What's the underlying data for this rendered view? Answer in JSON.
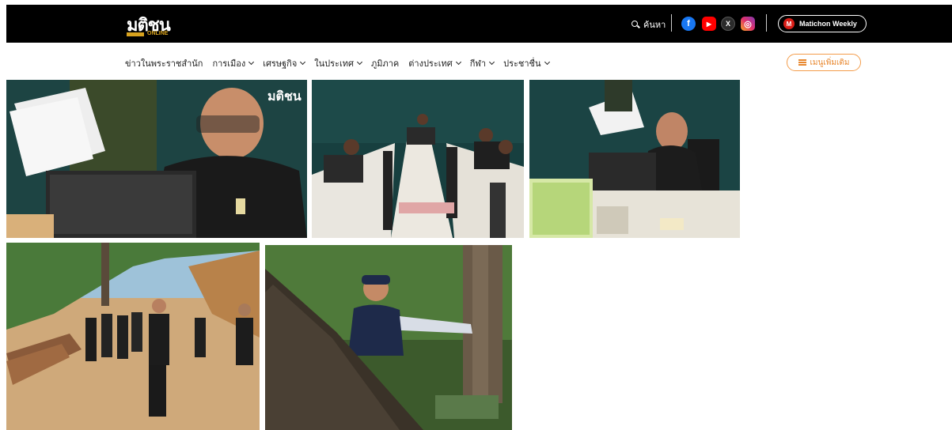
{
  "header": {
    "logo_main": "มติชน",
    "logo_sub": "ONLINE",
    "search_label": "ค้นหา",
    "social": [
      {
        "icon": "facebook-icon",
        "glyph": "f",
        "color": "#1877f2"
      },
      {
        "icon": "youtube-icon",
        "glyph": "▶",
        "color": "#ff0000"
      },
      {
        "icon": "x-icon",
        "glyph": "X",
        "color": "#2b2b2b"
      },
      {
        "icon": "instagram-icon",
        "glyph": "◎",
        "color": "#e1306c"
      }
    ],
    "weekly_label": "Matichon Weekly",
    "weekly_badge": "M"
  },
  "nav": {
    "items": [
      {
        "label": "ข่าวในพระราชสำนัก",
        "dropdown": false
      },
      {
        "label": "การเมือง",
        "dropdown": true
      },
      {
        "label": "เศรษฐกิจ",
        "dropdown": true
      },
      {
        "label": "ในประเทศ",
        "dropdown": true
      },
      {
        "label": "ภูมิภาค",
        "dropdown": false
      },
      {
        "label": "ต่างประเทศ",
        "dropdown": true
      },
      {
        "label": "กีฬา",
        "dropdown": true
      },
      {
        "label": "ประชาชื่น",
        "dropdown": true
      }
    ],
    "more_label": "เมนูเพิ่มเติม"
  },
  "gallery": {
    "watermark": "มติชน",
    "photos": [
      {
        "name": "photo-official-holding-papers"
      },
      {
        "name": "photo-meeting-room-table"
      },
      {
        "name": "photo-official-at-desk"
      },
      {
        "name": "photo-forest-walk"
      },
      {
        "name": "photo-inspecting-tree"
      }
    ]
  },
  "colors": {
    "topbar": "#000000",
    "accent": "#e8872e",
    "weekly": "#d91e18"
  }
}
